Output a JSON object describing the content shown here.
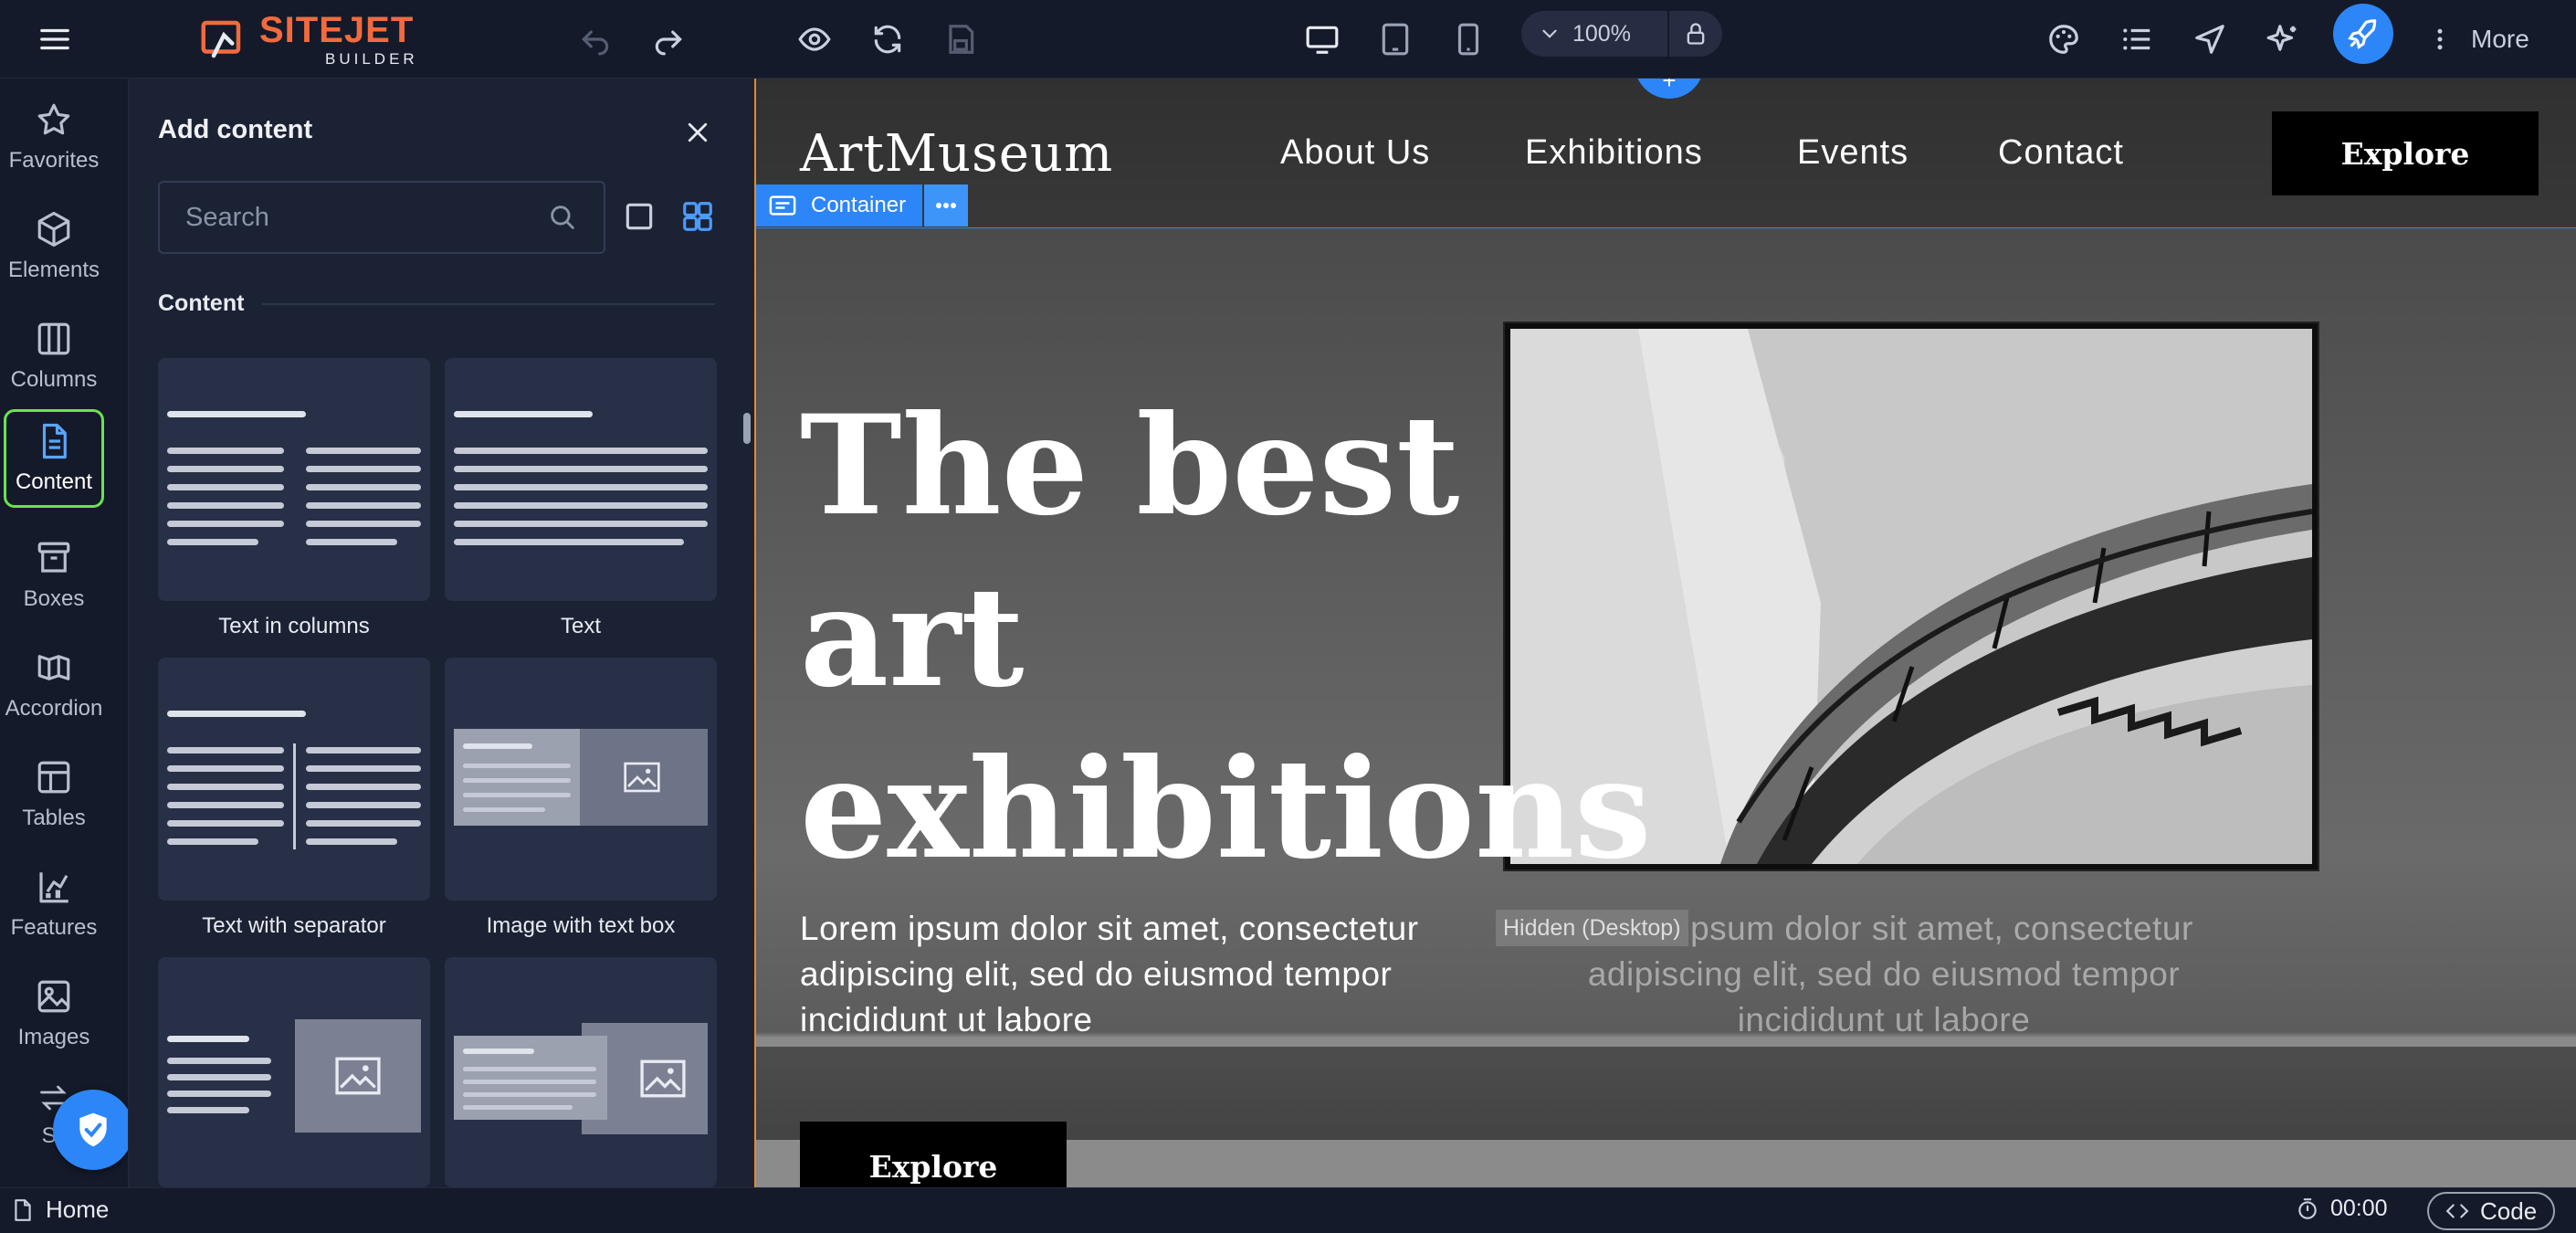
{
  "app": {
    "logo_main": "SITEJET",
    "logo_sub": "BUILDER",
    "brand_color": "#f26a3d",
    "accent_color": "#2c86f7"
  },
  "toolbar": {
    "zoom": "100%",
    "more_label": "More",
    "icons": [
      "menu-icon",
      "undo-icon",
      "redo-icon",
      "preview-eye-icon",
      "refresh-icon",
      "save-icon",
      "desktop-icon",
      "tablet-icon",
      "mobile-icon",
      "chevron-down-icon",
      "lock-icon",
      "palette-icon",
      "list-icon",
      "navigate-icon",
      "sparkle-icon",
      "rocket-icon",
      "kebab-icon"
    ]
  },
  "rail": {
    "items": [
      {
        "label": "Favorites",
        "icon": "star-icon"
      },
      {
        "label": "Elements",
        "icon": "cube-icon"
      },
      {
        "label": "Columns",
        "icon": "columns-icon"
      },
      {
        "label": "Content",
        "icon": "document-icon",
        "active": true
      },
      {
        "label": "Boxes",
        "icon": "archive-icon"
      },
      {
        "label": "Accordion",
        "icon": "accordion-icon"
      },
      {
        "label": "Tables",
        "icon": "table-icon"
      },
      {
        "label": "Features",
        "icon": "features-icon"
      },
      {
        "label": "Images",
        "icon": "image-icon"
      },
      {
        "label": "Sli",
        "icon": "arrows-icon"
      }
    ]
  },
  "panel": {
    "title": "Add content",
    "search_placeholder": "Search",
    "section": "Content",
    "tiles": [
      {
        "label": "Text in columns"
      },
      {
        "label": "Text"
      },
      {
        "label": "Text with separator"
      },
      {
        "label": "Image with text box"
      },
      {
        "label": ""
      },
      {
        "label": ""
      }
    ]
  },
  "site": {
    "logo": "ArtMuseum",
    "nav": [
      "About Us",
      "Exhibitions",
      "Events",
      "Contact"
    ],
    "cta_top": "Explore",
    "container_label": "Container",
    "hero_title": "The best\nart\nexhibitions",
    "hero_text": "Lorem ipsum dolor sit amet, consectetur adipiscing elit, sed do eiusmod tempor incididunt ut labore",
    "hidden_badge": "Hidden (Desktop)",
    "hero_text_ghost": "Lorem ipsum dolor sit amet, consectetur adipiscing elit, sed do eiusmod tempor incididunt ut labore",
    "cta_bottom": "Explore"
  },
  "status": {
    "page": "Home",
    "timer": "00:00",
    "code": "Code"
  }
}
